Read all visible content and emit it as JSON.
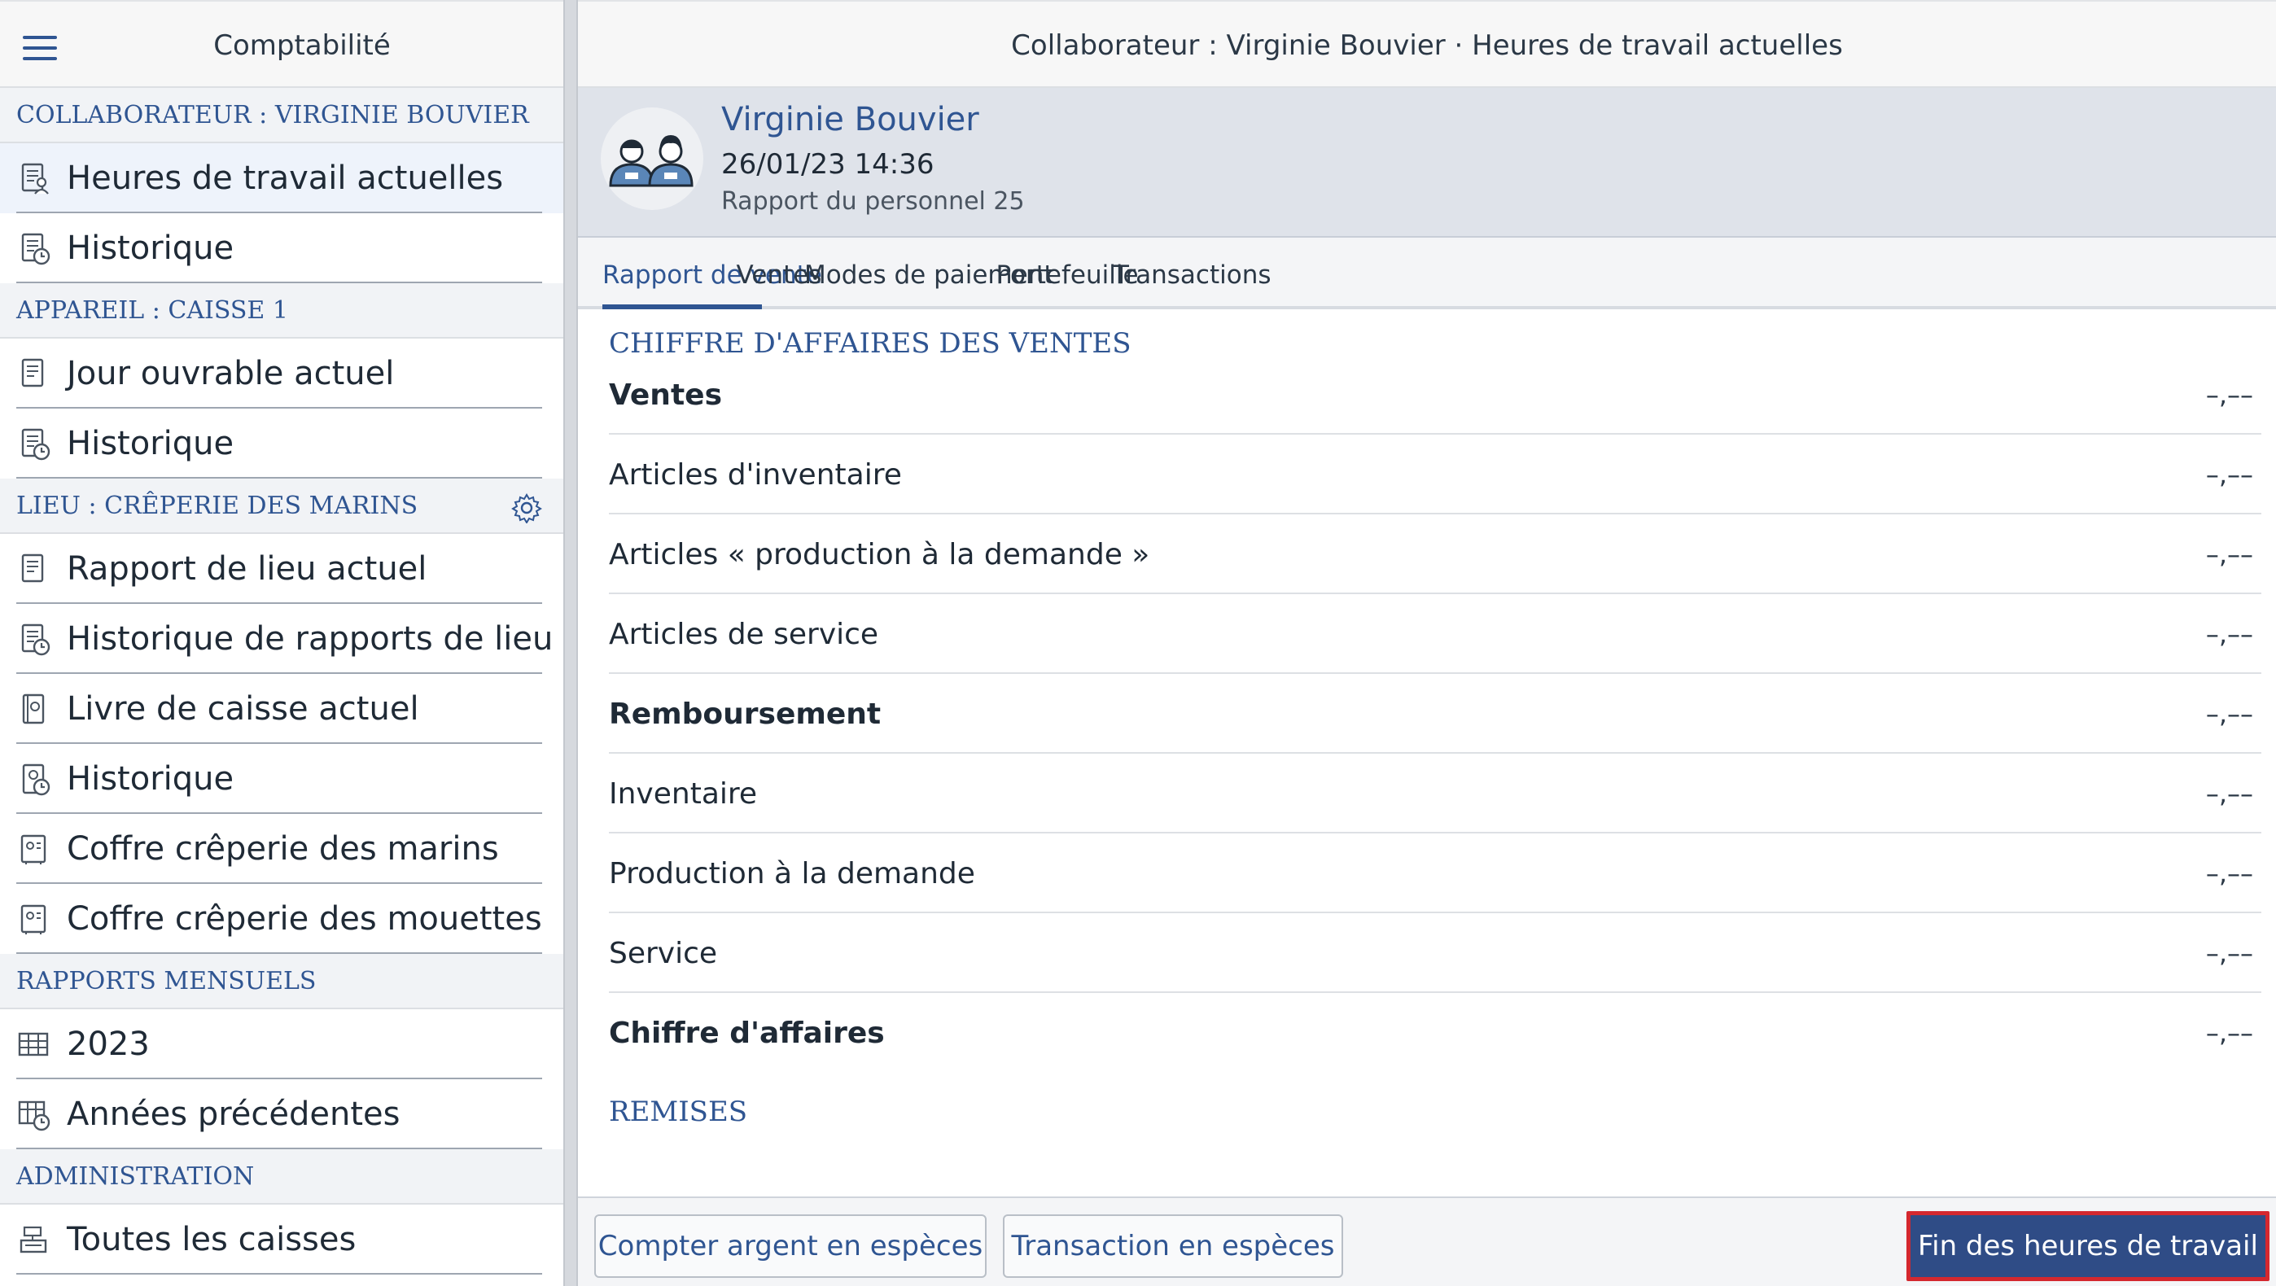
{
  "sidebar": {
    "title": "Comptabilité",
    "sections": [
      {
        "header": "COLLABORATEUR : VIRGINIE BOUVIER",
        "items": [
          {
            "label": "Heures de travail actuelles",
            "icon": "employee-report-icon",
            "active": true
          },
          {
            "label": "Historique",
            "icon": "employee-history-icon"
          }
        ]
      },
      {
        "header": "APPAREIL : CAISSE 1",
        "items": [
          {
            "label": "Jour ouvrable actuel",
            "icon": "receipt-icon"
          },
          {
            "label": "Historique",
            "icon": "receipt-history-icon"
          }
        ]
      },
      {
        "header": "LIEU : CRÊPERIE DES MARINS",
        "has_settings": true,
        "items": [
          {
            "label": "Rapport de lieu actuel",
            "icon": "receipt-icon"
          },
          {
            "label": "Historique de rapports de lieu",
            "icon": "receipt-history-icon"
          },
          {
            "label": "Livre de caisse actuel",
            "icon": "cash-book-icon"
          },
          {
            "label": "Historique",
            "icon": "cash-book-history-icon"
          },
          {
            "label": "Coffre crêperie des marins",
            "icon": "safe-icon"
          },
          {
            "label": "Coffre crêperie des mouettes",
            "icon": "safe-icon"
          }
        ]
      },
      {
        "header": "RAPPORTS MENSUELS",
        "items": [
          {
            "label": "2023",
            "icon": "calendar-grid-icon"
          },
          {
            "label": "Années précédentes",
            "icon": "calendar-history-icon"
          }
        ]
      },
      {
        "header": "ADMINISTRATION",
        "items": [
          {
            "label": "Toutes les caisses",
            "icon": "cash-register-icon"
          }
        ]
      }
    ]
  },
  "main": {
    "title": "Collaborateur : Virginie Bouvier · Heures de travail actuelles",
    "profile": {
      "name": "Virginie Bouvier",
      "datetime": "26/01/23 14:36",
      "report": "Rapport du personnel 25",
      "avatar_icon": "staff-pair-icon"
    },
    "tabs": [
      {
        "label": "Rapport de vente",
        "active": true
      },
      {
        "label": "Ventes"
      },
      {
        "label": "Modes de paiement"
      },
      {
        "label": "Portefeuille"
      },
      {
        "label": "Transactions"
      }
    ],
    "sections": [
      {
        "header": "CHIFFRE D'AFFAIRES DES VENTES",
        "rows": [
          {
            "label": "Ventes",
            "value": "–,––",
            "bold": true
          },
          {
            "label": "Articles d'inventaire",
            "value": "–,––"
          },
          {
            "label": "Articles « production à la demande »",
            "value": "–,––"
          },
          {
            "label": "Articles de service",
            "value": "–,––"
          },
          {
            "label": "Remboursement",
            "value": "–,––",
            "bold": true
          },
          {
            "label": "Inventaire",
            "value": "–,––"
          },
          {
            "label": "Production à la demande",
            "value": "–,––"
          },
          {
            "label": "Service",
            "value": "–,––"
          },
          {
            "label": "Chiffre d'affaires",
            "value": "–,––",
            "bold": true
          }
        ]
      },
      {
        "header": "REMISES",
        "rows": []
      }
    ],
    "buttons": {
      "count_cash": "Compter argent en espèces",
      "cash_transaction": "Transaction en espèces",
      "end_shift": "Fin des heures de travail"
    }
  },
  "colors": {
    "accent": "#2f5592",
    "primary_button": "#2f4c86",
    "highlight_border": "#d4282f"
  }
}
